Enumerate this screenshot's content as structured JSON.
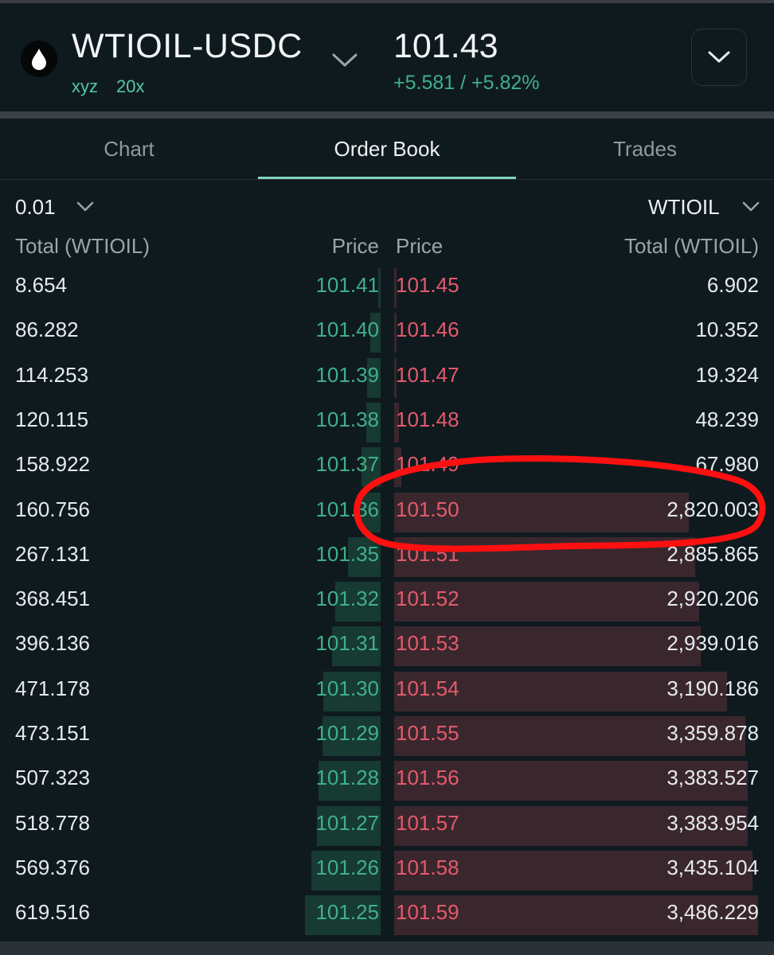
{
  "header": {
    "pair": "WTIOIL-USDC",
    "dex": "xyz",
    "leverage": "20x",
    "price": "101.43",
    "change": "+5.581 / +5.82%",
    "logo_icon": "oil-drop-icon"
  },
  "tabs": [
    {
      "label": "Chart",
      "active": false
    },
    {
      "label": "Order Book",
      "active": true
    },
    {
      "label": "Trades",
      "active": false
    }
  ],
  "controls": {
    "tick_size": "0.01",
    "unit": "WTIOIL"
  },
  "columns": {
    "bid_total": "Total (WTIOIL)",
    "bid_price": "Price",
    "ask_price": "Price",
    "ask_total": "Total (WTIOIL)"
  },
  "rows": [
    {
      "bid_total": "8.654",
      "bid_price": "101.41",
      "ask_price": "101.45",
      "ask_total": "6.902",
      "bid_depth": 0.014,
      "ask_depth": 0.002
    },
    {
      "bid_total": "86.282",
      "bid_price": "101.40",
      "ask_price": "101.46",
      "ask_total": "10.352",
      "bid_depth": 0.139,
      "ask_depth": 0.003
    },
    {
      "bid_total": "114.253",
      "bid_price": "101.39",
      "ask_price": "101.47",
      "ask_total": "19.324",
      "bid_depth": 0.184,
      "ask_depth": 0.006
    },
    {
      "bid_total": "120.115",
      "bid_price": "101.38",
      "ask_price": "101.48",
      "ask_total": "48.239",
      "bid_depth": 0.194,
      "ask_depth": 0.014
    },
    {
      "bid_total": "158.922",
      "bid_price": "101.37",
      "ask_price": "101.49",
      "ask_total": "67.980",
      "bid_depth": 0.257,
      "ask_depth": 0.019
    },
    {
      "bid_total": "160.756",
      "bid_price": "101.36",
      "ask_price": "101.50",
      "ask_total": "2,820.003",
      "bid_depth": 0.259,
      "ask_depth": 0.809
    },
    {
      "bid_total": "267.131",
      "bid_price": "101.35",
      "ask_price": "101.51",
      "ask_total": "2,885.865",
      "bid_depth": 0.431,
      "ask_depth": 0.828
    },
    {
      "bid_total": "368.451",
      "bid_price": "101.32",
      "ask_price": "101.52",
      "ask_total": "2,920.206",
      "bid_depth": 0.595,
      "ask_depth": 0.838
    },
    {
      "bid_total": "396.136",
      "bid_price": "101.31",
      "ask_price": "101.53",
      "ask_total": "2,939.016",
      "bid_depth": 0.639,
      "ask_depth": 0.843
    },
    {
      "bid_total": "471.178",
      "bid_price": "101.30",
      "ask_price": "101.54",
      "ask_total": "3,190.186",
      "bid_depth": 0.761,
      "ask_depth": 0.915
    },
    {
      "bid_total": "473.151",
      "bid_price": "101.29",
      "ask_price": "101.55",
      "ask_total": "3,359.878",
      "bid_depth": 0.764,
      "ask_depth": 0.964
    },
    {
      "bid_total": "507.323",
      "bid_price": "101.28",
      "ask_price": "101.56",
      "ask_total": "3,383.527",
      "bid_depth": 0.819,
      "ask_depth": 0.971
    },
    {
      "bid_total": "518.778",
      "bid_price": "101.27",
      "ask_price": "101.57",
      "ask_total": "3,383.954",
      "bid_depth": 0.837,
      "ask_depth": 0.971
    },
    {
      "bid_total": "569.376",
      "bid_price": "101.26",
      "ask_price": "101.58",
      "ask_total": "3,435.104",
      "bid_depth": 0.919,
      "ask_depth": 0.985
    },
    {
      "bid_total": "619.516",
      "bid_price": "101.25",
      "ask_price": "101.59",
      "ask_total": "3,486.229",
      "bid_depth": 1.0,
      "ask_depth": 1.0
    }
  ],
  "colors": {
    "background": "#0f1a1f",
    "bid": "#3fb08a",
    "ask": "#e45a6b",
    "bid_bar": "#173a32",
    "ask_bar": "#3a272e",
    "accent": "#7fd3c2",
    "annotation": "#ff1010"
  },
  "annotation": {
    "shape": "hand-drawn-ellipse",
    "highlights_ask_price": "101.50"
  }
}
